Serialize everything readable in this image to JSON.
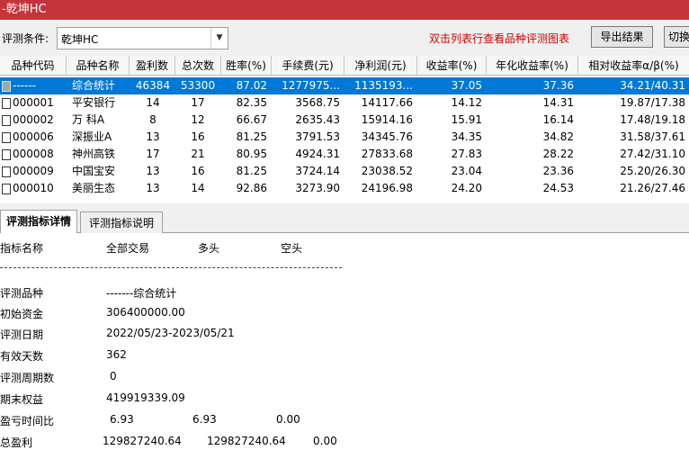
{
  "window": {
    "title": "-乾坤HC"
  },
  "toolbar": {
    "condition_label": "评测条件:",
    "condition_value": "乾坤HC",
    "hint": "双击列表行查看品种评测图表",
    "export_label": "导出结果",
    "switch_label": "切换"
  },
  "grid": {
    "columns": [
      "品种代码",
      "品种名称",
      "盈利数",
      "总次数",
      "胜率(%)",
      "手续费(元)",
      "净利润(元)",
      "收益率(%)",
      "年化收益率(%)",
      "相对收益率α/β(%)"
    ],
    "rows": [
      {
        "code": "------",
        "name": "综合统计",
        "win": "46384",
        "total": "53300",
        "rate": "87.02",
        "fee": "1277975...",
        "net": "1135193...",
        "ret": "37.05",
        "ann": "37.36",
        "rel": "34.21/40.31",
        "selected": true
      },
      {
        "code": "000001",
        "name": "平安银行",
        "win": "14",
        "total": "17",
        "rate": "82.35",
        "fee": "3568.75",
        "net": "14117.66",
        "ret": "14.12",
        "ann": "14.31",
        "rel": "19.87/17.38"
      },
      {
        "code": "000002",
        "name": "万 科A",
        "win": "8",
        "total": "12",
        "rate": "66.67",
        "fee": "2635.43",
        "net": "15914.16",
        "ret": "15.91",
        "ann": "16.14",
        "rel": "17.48/19.18"
      },
      {
        "code": "000006",
        "name": "深振业A",
        "win": "13",
        "total": "16",
        "rate": "81.25",
        "fee": "3791.53",
        "net": "34345.76",
        "ret": "34.35",
        "ann": "34.82",
        "rel": "31.58/37.61"
      },
      {
        "code": "000008",
        "name": "神州高铁",
        "win": "17",
        "total": "21",
        "rate": "80.95",
        "fee": "4924.31",
        "net": "27833.68",
        "ret": "27.83",
        "ann": "28.22",
        "rel": "27.42/31.10"
      },
      {
        "code": "000009",
        "name": "中国宝安",
        "win": "13",
        "total": "16",
        "rate": "81.25",
        "fee": "3724.14",
        "net": "23038.52",
        "ret": "23.04",
        "ann": "23.36",
        "rel": "25.20/26.30"
      },
      {
        "code": "000010",
        "name": "美丽生态",
        "win": "13",
        "total": "14",
        "rate": "92.86",
        "fee": "3273.90",
        "net": "24196.98",
        "ret": "24.20",
        "ann": "24.53",
        "rel": "21.26/27.46"
      }
    ]
  },
  "tabs": {
    "detail": "评测指标详情",
    "explain": "评测指标说明"
  },
  "detail": {
    "header": {
      "name": "指标名称",
      "all": "全部交易",
      "long": "多头",
      "short": "空头"
    },
    "items": [
      {
        "label": "评测品种",
        "v1": "-------综合统计",
        "v2": "",
        "v3": ""
      },
      {
        "label": "初始资金",
        "v1": "306400000.00",
        "v2": "",
        "v3": ""
      },
      {
        "label": "评测日期",
        "v1": "2022/05/23-2023/05/21",
        "v2": "",
        "v3": ""
      },
      {
        "label": "有效天数",
        "v1": "362",
        "v2": "",
        "v3": ""
      },
      {
        "label": "评测周期数",
        "v1": "0",
        "v2": "",
        "v3": ""
      },
      {
        "label": "期末权益",
        "v1": "419919339.09",
        "v2": "",
        "v3": ""
      },
      {
        "label": "盈亏时间比",
        "v1": "6.93",
        "v2": "6.93",
        "v3": "0.00"
      },
      {
        "label": "总盈利",
        "v1": "129827240.64",
        "v2": "129827240.64",
        "v3": "0.00"
      }
    ]
  },
  "colors": {
    "titlebar": "#c4343a",
    "selection": "#0078d7",
    "hint": "#d00000"
  }
}
